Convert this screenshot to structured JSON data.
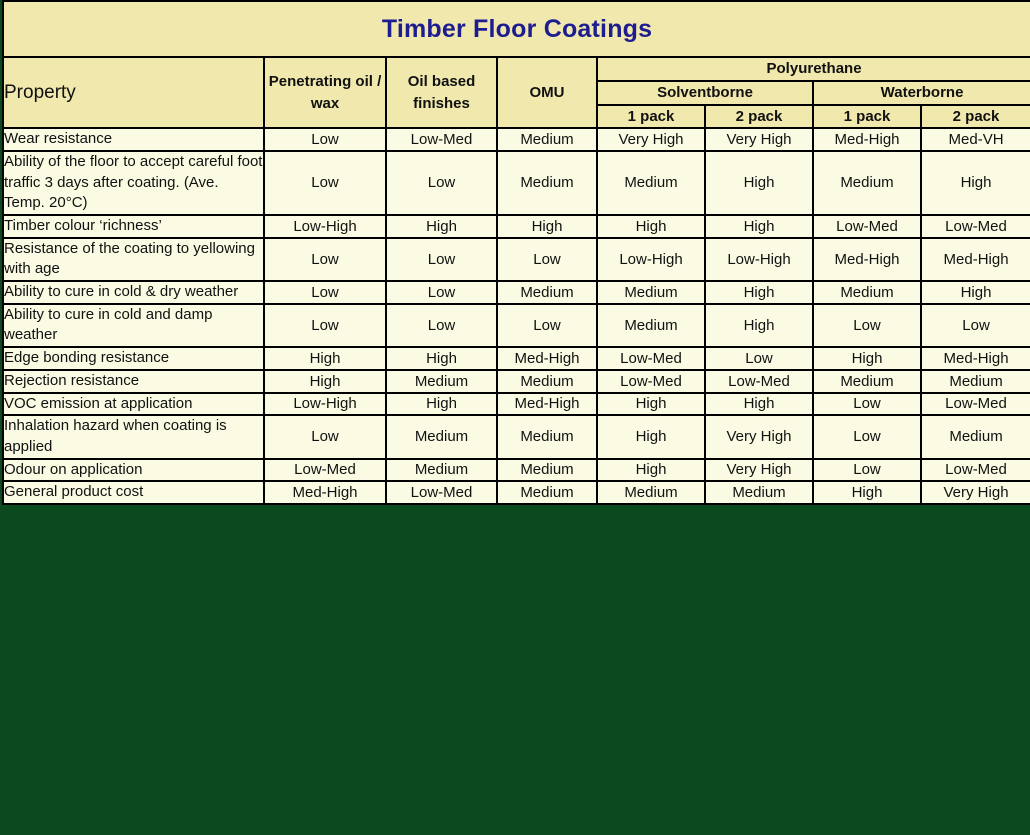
{
  "title": "Timber Floor Coatings",
  "colors": {
    "page_background": "#0b4a1e",
    "header_background": "#f0e8ad",
    "cell_background": "#fbfbe4",
    "title_text": "#1d1d8f",
    "header_text": "#1a1ad2",
    "body_text": "#111111",
    "border": "#000000"
  },
  "header": {
    "property_label": "Property",
    "penetrating": "Penetrating oil / wax",
    "oil_based": "Oil based finishes",
    "omu": "OMU",
    "polyurethane": "Polyurethane",
    "solventborne": "Solventborne",
    "waterborne": "Waterborne",
    "pack_labels": [
      "1 pack",
      "2 pack",
      "1 pack",
      "2 pack"
    ]
  },
  "chart_data": {
    "type": "table",
    "title": "Timber Floor Coatings",
    "row_header_label": "Property",
    "column_groups": [
      {
        "label": "Penetrating oil / wax",
        "span": 1
      },
      {
        "label": "Oil based finishes",
        "span": 1
      },
      {
        "label": "OMU",
        "span": 1
      },
      {
        "label": "Polyurethane",
        "span": 4,
        "subgroups": [
          {
            "label": "Solventborne",
            "span": 2,
            "columns": [
              "1 pack",
              "2 pack"
            ]
          },
          {
            "label": "Waterborne",
            "span": 2,
            "columns": [
              "1 pack",
              "2 pack"
            ]
          }
        ]
      }
    ],
    "columns": [
      "Penetrating oil / wax",
      "Oil based finishes",
      "OMU",
      "Polyurethane Solventborne 1 pack",
      "Polyurethane Solventborne 2 pack",
      "Polyurethane Waterborne 1 pack",
      "Polyurethane Waterborne 2 pack"
    ],
    "rows": [
      {
        "property": "Wear resistance",
        "values": [
          "Low",
          "Low-Med",
          "Medium",
          "Very High",
          "Very High",
          "Med-High",
          "Med-VH"
        ]
      },
      {
        "property": "Ability of the floor to accept careful foot traffic 3 days after coating. (Ave. Temp. 20°C)",
        "values": [
          "Low",
          "Low",
          "Medium",
          "Medium",
          "High",
          "Medium",
          "High"
        ]
      },
      {
        "property": "Timber colour ‘richness’",
        "values": [
          "Low-High",
          "High",
          "High",
          "High",
          "High",
          "Low-Med",
          "Low-Med"
        ]
      },
      {
        "property": "Resistance of the coating to yellowing with age",
        "values": [
          "Low",
          "Low",
          "Low",
          "Low-High",
          "Low-High",
          "Med-High",
          "Med-High"
        ]
      },
      {
        "property": "Ability to cure in cold & dry weather",
        "values": [
          "Low",
          "Low",
          "Medium",
          "Medium",
          "High",
          "Medium",
          "High"
        ]
      },
      {
        "property": "Ability to cure in cold and damp weather",
        "values": [
          "Low",
          "Low",
          "Low",
          "Medium",
          "High",
          "Low",
          "Low"
        ]
      },
      {
        "property": "Edge bonding resistance",
        "values": [
          "High",
          "High",
          "Med-High",
          "Low-Med",
          "Low",
          "High",
          "Med-High"
        ]
      },
      {
        "property": "Rejection resistance",
        "values": [
          "High",
          "Medium",
          "Medium",
          "Low-Med",
          "Low-Med",
          "Medium",
          "Medium"
        ]
      },
      {
        "property": "VOC emission at application",
        "values": [
          "Low-High",
          "High",
          "Med-High",
          "High",
          "High",
          "Low",
          "Low-Med"
        ]
      },
      {
        "property": "Inhalation hazard when coating is applied",
        "values": [
          "Low",
          "Medium",
          "Medium",
          "High",
          "Very High",
          "Low",
          "Medium"
        ]
      },
      {
        "property": "Odour on application",
        "values": [
          "Low-Med",
          "Medium",
          "Medium",
          "High",
          "Very High",
          "Low",
          "Low-Med"
        ]
      },
      {
        "property": "General product cost",
        "values": [
          "Med-High",
          "Low-Med",
          "Medium",
          "Medium",
          "Medium",
          "High",
          "Very High"
        ]
      }
    ]
  }
}
